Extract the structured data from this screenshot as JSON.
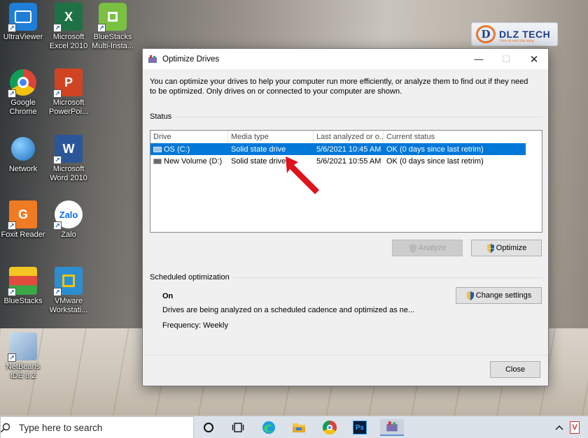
{
  "desktop": {
    "icons": [
      {
        "label": "UltraViewer",
        "color": "#1f7fd8",
        "glyph": "◉"
      },
      {
        "label": "Microsoft Excel 2010",
        "color": "#1e7145",
        "glyph": "X"
      },
      {
        "label": "BlueStacks Multi-Insta...",
        "color": "#7ac142",
        "glyph": "▦"
      },
      {
        "label": "Google Chrome",
        "color": "#ffffff",
        "glyph": ""
      },
      {
        "label": "Microsoft PowerPoi...",
        "color": "#d04423",
        "glyph": "P"
      },
      {
        "label": "Network",
        "color": "#2a8fd6",
        "glyph": "🖧"
      },
      {
        "label": "Microsoft Word 2010",
        "color": "#2b579a",
        "glyph": "W"
      },
      {
        "label": "Foxit Reader",
        "color": "#f07b22",
        "glyph": "G"
      },
      {
        "label": "Zalo",
        "color": "#0b6ff0",
        "glyph": "Zalo"
      },
      {
        "label": "BlueStacks",
        "color": "#3aa846",
        "glyph": "≣"
      },
      {
        "label": "VMware Workstati...",
        "color": "#2b8ed1",
        "glyph": "▣"
      },
      {
        "label": "NetBeans IDE 8.2",
        "color": "#9ab8d6",
        "glyph": "⬡"
      }
    ]
  },
  "watermark": {
    "letter": "D",
    "text": "DLZ TECH",
    "slogan": "Hơn cả một cửa hàng"
  },
  "dialog": {
    "title": "Optimize Drives",
    "description": "You can optimize your drives to help your computer run more efficiently, or analyze them to find out if they need to be optimized. Only drives on or connected to your computer are shown.",
    "status_label": "Status",
    "columns": [
      "Drive",
      "Media type",
      "Last analyzed or o...",
      "Current status"
    ],
    "drives": [
      {
        "drive": "OS (C:)",
        "media_type": "Solid state drive",
        "last_analyzed": "5/6/2021 10:45 AM",
        "status": "OK (0 days since last retrim)"
      },
      {
        "drive": "New Volume (D:)",
        "media_type": "Solid state drive",
        "last_analyzed": "5/6/2021 10:55 AM",
        "status": "OK (0 days since last retrim)"
      }
    ],
    "analyze_label": "Analyze",
    "optimize_label": "Optimize",
    "scheduled_label": "Scheduled optimization",
    "scheduled_state": "On",
    "scheduled_desc": "Drives are being analyzed on a scheduled cadence and optimized as ne...",
    "frequency": "Frequency: Weekly",
    "change_settings_label": "Change settings",
    "close_label": "Close"
  },
  "taskbar": {
    "search_placeholder": "Type here to search",
    "items": [
      "cortana-icon",
      "task-view-icon",
      "edge-icon",
      "file-explorer-icon",
      "chrome-icon",
      "photoshop-icon",
      "optimize-drives-icon"
    ],
    "photoshop_glyph": "Ps"
  },
  "colors": {
    "selection": "#0078d7",
    "arrow": "#e0121b",
    "button_face": "#e1e1e1"
  }
}
